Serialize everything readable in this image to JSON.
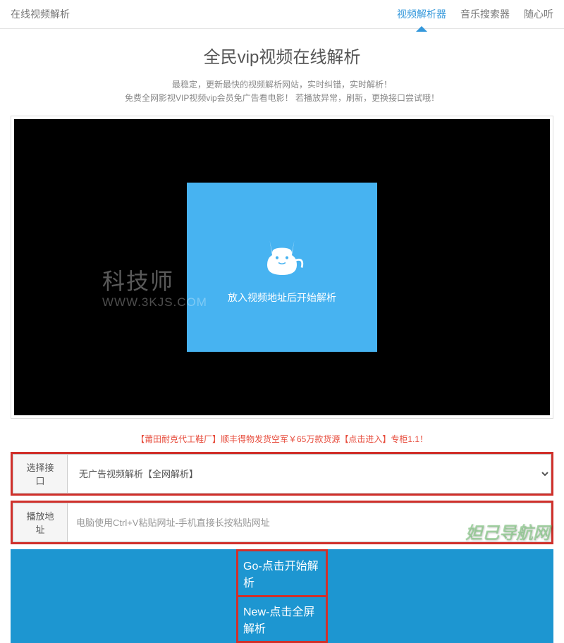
{
  "header": {
    "title": "在线视频解析",
    "nav": [
      {
        "label": "视频解析器",
        "active": true
      },
      {
        "label": "音乐搜索器",
        "active": false
      },
      {
        "label": "随心听",
        "active": false
      }
    ]
  },
  "main": {
    "title": "全民vip视频在线解析",
    "subtitle1": "最稳定，更新最快的视频解析网站，实时纠错，实时解析！",
    "subtitle2": "免费全网影视VIP视频vip会员免广告看电影！ 若播放异常，刷新，更换接口尝试哦！"
  },
  "video": {
    "placeholder_text": "放入视频地址后开始解析",
    "watermark1": "科技师",
    "watermark2": "WWW.3KJS.COM"
  },
  "promo": "【莆田耐克代工鞋厂】顺丰得物发货空军￥65万款货源【点击进入】专柜1.1！",
  "form": {
    "interface_label": "选择接口",
    "interface_value": "无广告视频解析【全网解析】",
    "address_label": "播放地址",
    "address_placeholder": "电脑使用Ctrl+V粘贴网址-手机直接长按粘贴网址"
  },
  "buttons": {
    "go": "Go-点击开始解析",
    "new": "New-点击全屏解析"
  },
  "bottom_watermark": "妲己导航网"
}
